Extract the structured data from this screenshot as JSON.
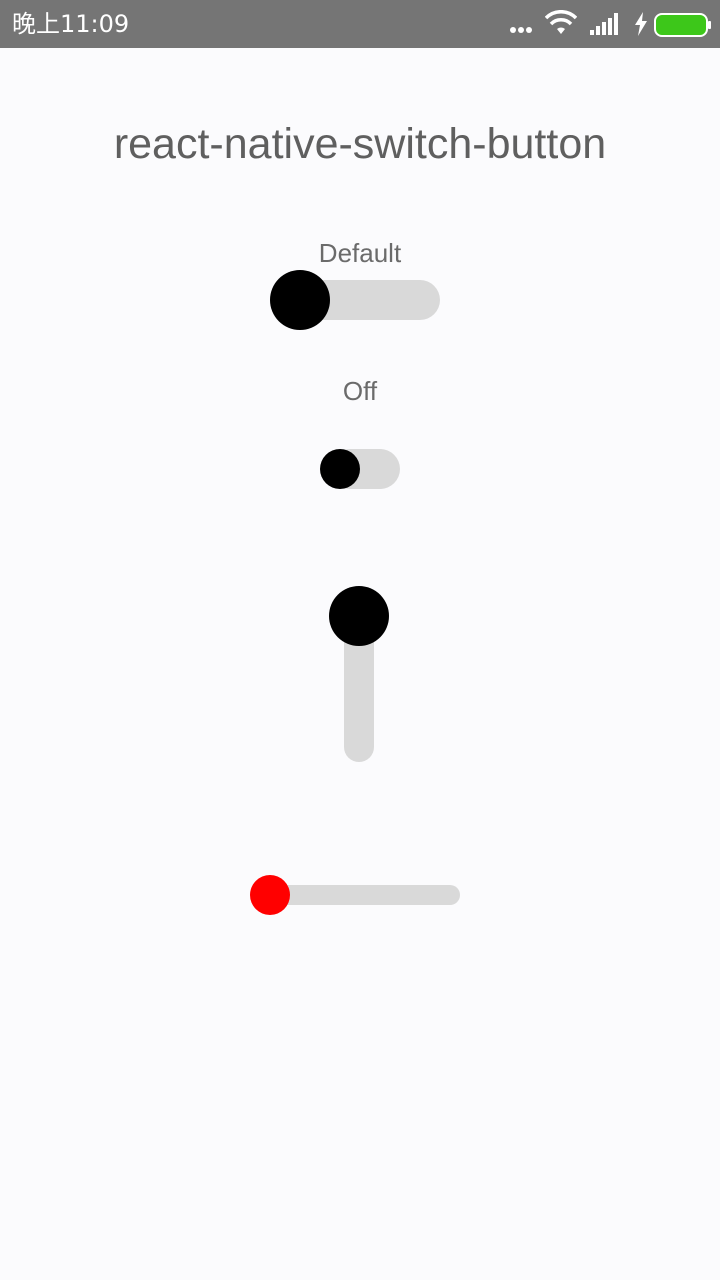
{
  "status_bar": {
    "time": "晚上11:09",
    "icons": [
      "more-dots-icon",
      "wifi-icon",
      "signal-icon",
      "charging-bolt-icon",
      "battery-icon"
    ],
    "battery_color": "#3DC71A"
  },
  "title": "react-native-switch-button",
  "switches": [
    {
      "label": "Default",
      "on": false,
      "orientation": "horizontal",
      "thumb_color": "#000000",
      "track_color": "#D9D9D9"
    },
    {
      "label": "Off",
      "on": false,
      "orientation": "horizontal",
      "thumb_color": "#000000",
      "track_color": "#D9D9D9"
    },
    {
      "label": "",
      "on": false,
      "orientation": "vertical",
      "thumb_color": "#000000",
      "track_color": "#D9D9D9"
    },
    {
      "label": "",
      "on": false,
      "orientation": "horizontal",
      "thumb_color": "#FF0000",
      "track_color": "#D9D9D9"
    }
  ]
}
